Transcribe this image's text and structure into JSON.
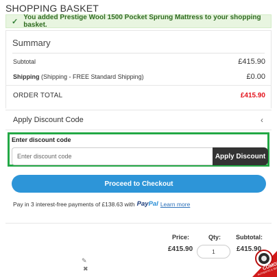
{
  "page": {
    "title": "SHOPPING BASKET"
  },
  "alert": {
    "message": "You added Prestige Wool 1500 Pocket Sprung Mattress to your shopping basket."
  },
  "summary": {
    "title": "Summary",
    "subtotal_label": "Subtotal",
    "subtotal_value": "£415.90",
    "shipping_label": "Shipping",
    "shipping_detail": "(Shipping - FREE Standard Shipping)",
    "shipping_value": "£0.00",
    "order_total_label": "ORDER TOTAL",
    "order_total_value": "£415.90"
  },
  "discount": {
    "toggle_label": "Apply Discount Code",
    "chevron": "‹",
    "field_label": "Enter discount code",
    "placeholder": "Enter discount code",
    "value": "",
    "apply_label": "Apply Discount"
  },
  "checkout": {
    "button_label": "Proceed to Checkout"
  },
  "paypal": {
    "text": "Pay in 3 interest-free payments of £138.63 with",
    "logo_pay": "Pay",
    "logo_pal": "Pal",
    "link": "Learn more"
  },
  "item": {
    "price_header": "Price:",
    "qty_header": "Qty:",
    "subtotal_header": "Subtotal:",
    "price": "£415.90",
    "qty": "1",
    "subtotal": "£415.90",
    "edit_icon": "pencil-icon",
    "remove_icon": "close-icon"
  },
  "badge": {
    "text": "COMODO",
    "subtext": "AUTHENTIC & SECURE"
  },
  "colors": {
    "alert_bg": "#e8f5e0",
    "alert_text": "#2e6b1f",
    "total_red": "#e3121b",
    "discount_border": "#22a845",
    "apply_bg": "#333333",
    "checkout_blue": "#2d95d8",
    "link_blue": "#2a6fb8"
  }
}
